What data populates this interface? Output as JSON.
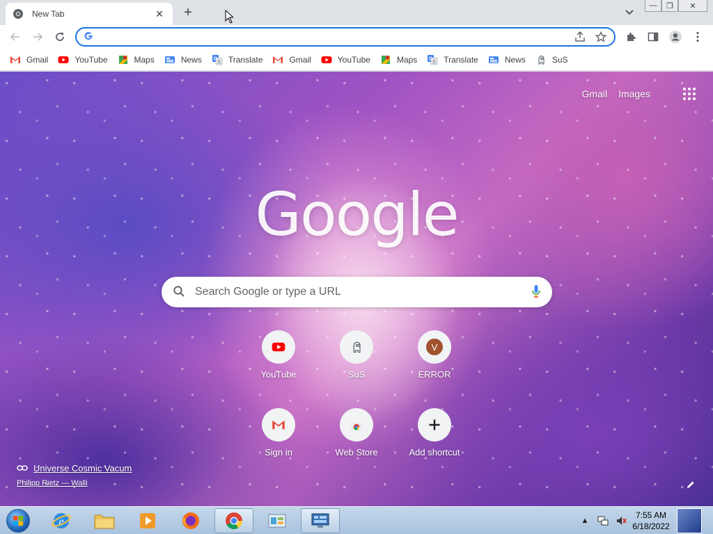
{
  "tab": {
    "title": "New Tab",
    "close": "✕"
  },
  "newtab": "+",
  "window": {
    "minimize": "—",
    "restore": "❐",
    "close": "✕"
  },
  "omnibox": {
    "value": "",
    "placeholder": ""
  },
  "bookmarks": [
    {
      "label": "Gmail",
      "icon": "gmail-icon"
    },
    {
      "label": "YouTube",
      "icon": "youtube-icon"
    },
    {
      "label": "Maps",
      "icon": "maps-icon"
    },
    {
      "label": "News",
      "icon": "news-icon"
    },
    {
      "label": "Translate",
      "icon": "translate-icon"
    },
    {
      "label": "Gmail",
      "icon": "gmail-icon"
    },
    {
      "label": "YouTube",
      "icon": "youtube-icon"
    },
    {
      "label": "Maps",
      "icon": "maps-icon"
    },
    {
      "label": "Translate",
      "icon": "translate-icon"
    },
    {
      "label": "News",
      "icon": "news-icon"
    },
    {
      "label": "SuS",
      "icon": "sus-icon"
    }
  ],
  "ntp": {
    "gmail": "Gmail",
    "images": "Images",
    "logo": "Google",
    "search_placeholder": "Search Google or type a URL",
    "shortcuts": [
      {
        "label": "YouTube",
        "icon": "youtube-icon"
      },
      {
        "label": "SuS",
        "icon": "sus-icon"
      },
      {
        "label": "ERROR",
        "icon": "letter-v-avatar",
        "letter": "V"
      },
      {
        "label": "Sign in",
        "icon": "gmail-icon"
      },
      {
        "label": "Web Store",
        "icon": "webstore-icon"
      },
      {
        "label": "Add shortcut",
        "icon": "plus-icon"
      }
    ],
    "attribution": {
      "title": "Universe Cosmic Vacum",
      "author": "Philipp Rietz — Walli"
    }
  },
  "taskbar": {
    "time": "7:55 AM",
    "date": "6/18/2022",
    "items": [
      "internet-explorer-icon",
      "file-explorer-icon",
      "media-player-icon",
      "firefox-icon",
      "chrome-icon",
      "control-panel-icon",
      "network-monitor-icon"
    ]
  },
  "colors": {
    "accent": "#1a73e8",
    "youtube_red": "#ff0000",
    "avatar_brown": "#a0522d"
  }
}
